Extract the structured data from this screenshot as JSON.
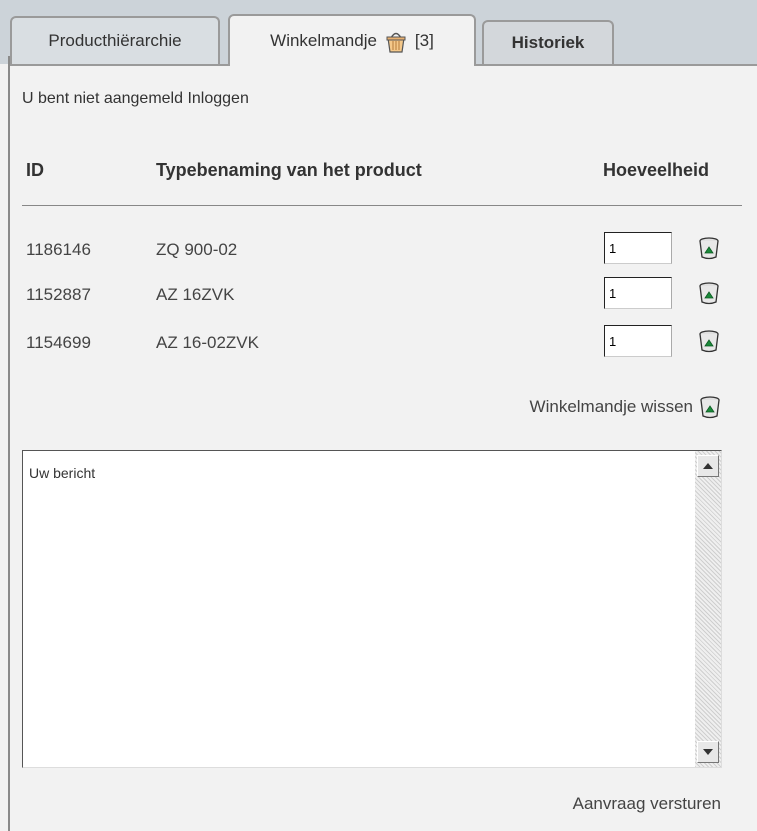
{
  "tabs": [
    {
      "label": "Producthiërarchie"
    },
    {
      "label": "Winkelmandje",
      "count": "[3]"
    },
    {
      "label": "Historiek"
    }
  ],
  "login": {
    "status": "U bent niet aangemeld",
    "link": "Inloggen"
  },
  "table": {
    "headers": {
      "id": "ID",
      "type": "Typebenaming van het product",
      "qty": "Hoeveelheid"
    },
    "rows": [
      {
        "id": "1186146",
        "type": "ZQ 900-02",
        "qty": "1"
      },
      {
        "id": "1152887",
        "type": "AZ 16ZVK",
        "qty": "1"
      },
      {
        "id": "1154699",
        "type": "AZ 16-02ZVK",
        "qty": "1"
      }
    ]
  },
  "clear_label": "Winkelmandje wissen",
  "message": {
    "placeholder": "Uw bericht"
  },
  "send_label": "Aanvraag versturen",
  "icons": {
    "basket": "basket-icon",
    "bin": "trash-bin-icon"
  },
  "colors": {
    "tabbar": "#ccd3d9",
    "panel": "#f2f2f2",
    "bin_green": "#1a8a3a"
  }
}
